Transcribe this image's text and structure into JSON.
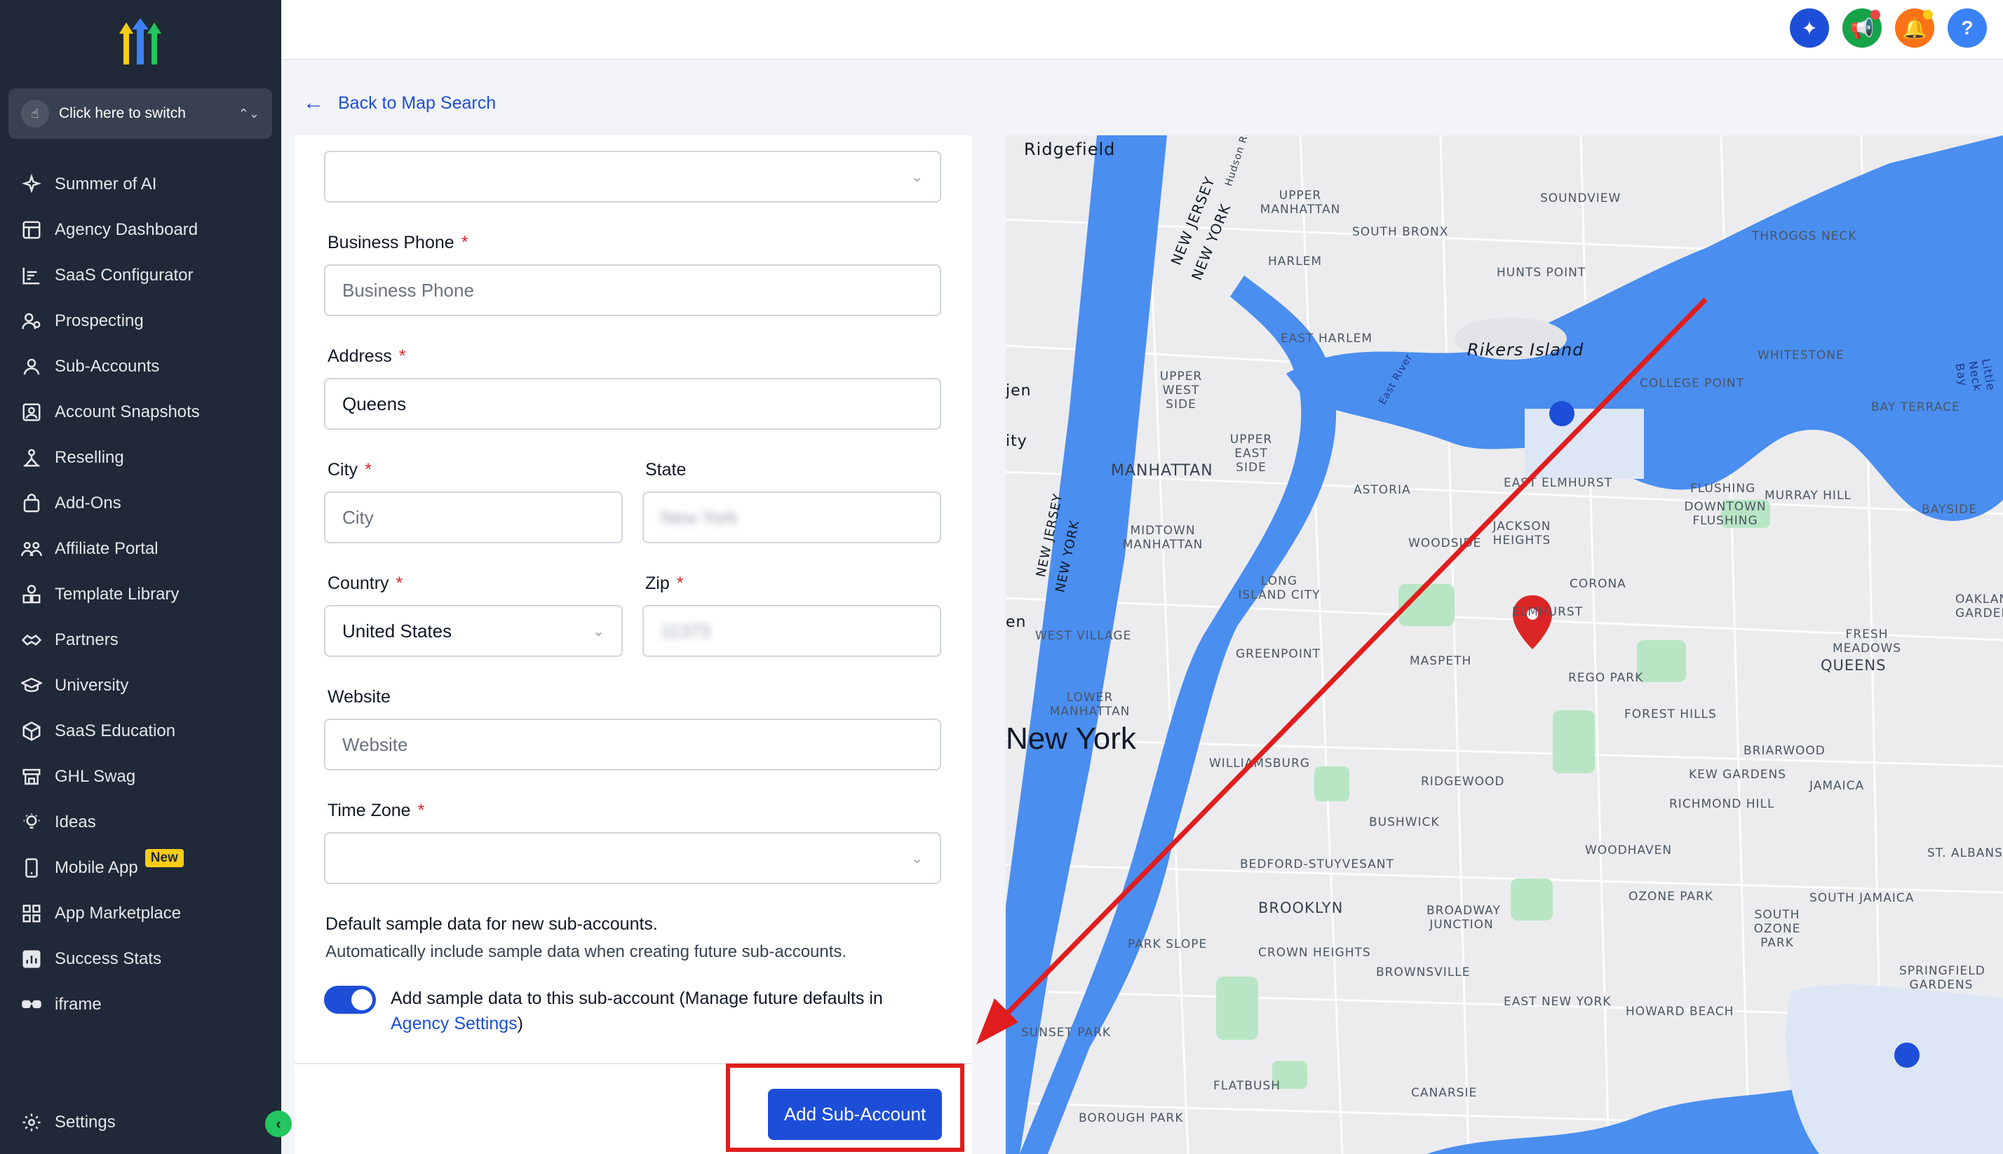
{
  "sidebar": {
    "switcher_label": "Click here to switch",
    "items": [
      {
        "label": "Summer of AI",
        "icon": "sparkle-icon"
      },
      {
        "label": "Agency Dashboard",
        "icon": "dashboard-icon"
      },
      {
        "label": "SaaS Configurator",
        "icon": "chart-icon"
      },
      {
        "label": "Prospecting",
        "icon": "users-search-icon"
      },
      {
        "label": "Sub-Accounts",
        "icon": "user-icon"
      },
      {
        "label": "Account Snapshots",
        "icon": "snapshot-icon"
      },
      {
        "label": "Reselling",
        "icon": "reselling-icon"
      },
      {
        "label": "Add-Ons",
        "icon": "bag-icon"
      },
      {
        "label": "Affiliate Portal",
        "icon": "group-icon"
      },
      {
        "label": "Template Library",
        "icon": "shapes-icon"
      },
      {
        "label": "Partners",
        "icon": "handshake-icon"
      },
      {
        "label": "University",
        "icon": "graduation-icon"
      },
      {
        "label": "SaaS Education",
        "icon": "cube-icon"
      },
      {
        "label": "GHL Swag",
        "icon": "store-icon"
      },
      {
        "label": "Ideas",
        "icon": "bulb-icon"
      },
      {
        "label": "Mobile App",
        "icon": "phone-icon",
        "badge": "New"
      },
      {
        "label": "App Marketplace",
        "icon": "grid-icon"
      },
      {
        "label": "Success Stats",
        "icon": "stats-icon"
      },
      {
        "label": "iframe",
        "icon": "glasses-icon"
      }
    ],
    "settings_label": "Settings"
  },
  "topbar": {
    "help_label": "?"
  },
  "back_link": "Back to Map Search",
  "form": {
    "business_phone": {
      "label": "Business Phone",
      "required": "*",
      "placeholder": "Business Phone"
    },
    "address": {
      "label": "Address",
      "required": "*",
      "value": "Queens"
    },
    "city": {
      "label": "City",
      "required": "*",
      "placeholder": "City"
    },
    "state": {
      "label": "State",
      "value": "New York"
    },
    "country": {
      "label": "Country",
      "required": "*",
      "value": "United States"
    },
    "zip": {
      "label": "Zip",
      "required": "*",
      "value": "11373"
    },
    "website": {
      "label": "Website",
      "placeholder": "Website"
    },
    "timezone": {
      "label": "Time Zone",
      "required": "*"
    },
    "sample": {
      "title": "Default sample data for new sub-accounts.",
      "desc": "Automatically include sample data when creating future sub-accounts.",
      "toggle_text": "Add sample data to this sub-account (Manage future defaults in ",
      "link": "Agency Settings",
      "toggle_tail": ")"
    },
    "submit": "Add Sub-Account"
  },
  "map": {
    "labels": {
      "ridgefield": "Ridgefield",
      "upper_manhattan": "UPPER MANHATTAN",
      "soundview": "SOUNDVIEW",
      "south_bronx": "SOUTH BRONX",
      "throggs_neck": "THROGGS NECK",
      "harlem": "HARLEM",
      "hunts_point": "HUNTS POINT",
      "new_jersey": "NEW JERSEY",
      "new_york_state": "NEW YORK",
      "east_harlem": "EAST HARLEM",
      "rikers": "Rikers Island",
      "whitestone": "WHITESTONE",
      "college_point": "COLLEGE POINT",
      "bay_terrace": "BAY TERRACE",
      "upper_west": "UPPER WEST SIDE",
      "upper_east": "UPPER EAST SIDE",
      "manhattan": "MANHATTAN",
      "astoria": "ASTORIA",
      "east_elmhurst": "EAST ELMHURST",
      "flushing": "FLUSHING",
      "murray_hill": "MURRAY HILL",
      "downtown_flushing": "DOWNTOWN FLUSHING",
      "bayside": "BAYSIDE",
      "midtown": "MIDTOWN MANHATTAN",
      "woodside": "WOODSIDE",
      "jackson_heights": "JACKSON HEIGHTS",
      "long_island_city": "LONG ISLAND CITY",
      "corona": "CORONA",
      "oakland_gardens": "OAKLAND GARDENS",
      "elmhurst": "ELMHURST",
      "west_village": "WEST VILLAGE",
      "greenpoint": "GREENPOINT",
      "maspeth": "MASPETH",
      "fresh_meadows": "FRESH MEADOWS",
      "queens": "QUEENS",
      "rego_park": "REGO PARK",
      "lower_manhattan": "LOWER MANHATTAN",
      "forest_hills": "FOREST HILLS",
      "new_york": "New York",
      "williamsburg": "WILLIAMSBURG",
      "briarwood": "BRIARWOOD",
      "ridgewood": "RIDGEWOOD",
      "kew_gardens": "KEW GARDENS",
      "jamaica": "JAMAICA",
      "richmond_hill": "RICHMOND HILL",
      "bushwick": "BUSHWICK",
      "woodhaven": "WOODHAVEN",
      "st_albans": "ST. ALBANS",
      "bedford": "BEDFORD-STUYVESANT",
      "ozone_park": "OZONE PARK",
      "south_jamaica": "SOUTH JAMAICA",
      "brooklyn": "BROOKLYN",
      "broadway_junction": "BROADWAY JUNCTION",
      "south_ozone": "SOUTH OZONE PARK",
      "park_slope": "PARK SLOPE",
      "crown_heights": "CROWN HEIGHTS",
      "brownsville": "BROWNSVILLE",
      "springfield": "SPRINGFIELD GARDENS",
      "east_new_york": "EAST NEW YORK",
      "howard_beach": "HOWARD BEACH",
      "sunset_park": "SUNSET PARK",
      "flatbush": "FLATBUSH",
      "canarsie": "CANARSIE",
      "borough_park": "BOROUGH PARK",
      "jen": "jen",
      "ity": "ity",
      "en": "en",
      "hudson": "Hudson Ri",
      "east_river": "East River",
      "little_neck": "Little Neck Bay"
    }
  },
  "colors": {
    "sidebar_bg": "#1f2937",
    "primary": "#1d4ed8",
    "highlight": "#e11d1d",
    "water": "#4a8ef0",
    "park": "#b8e6c4"
  }
}
